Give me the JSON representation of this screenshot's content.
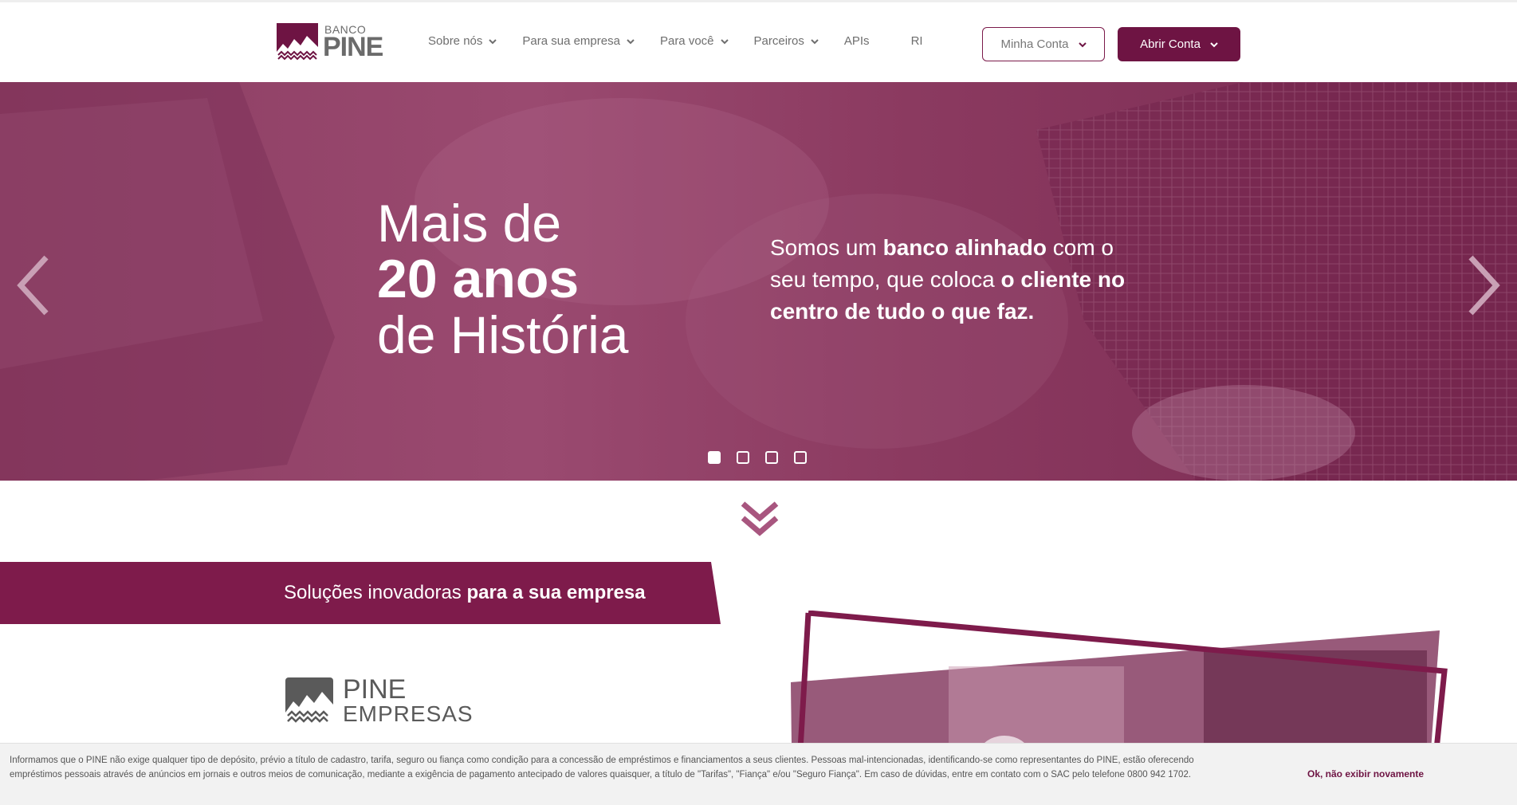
{
  "colors": {
    "brand": "#6e1443",
    "hero": "#8c3d62",
    "text": "#6e6e6e"
  },
  "header": {
    "logo_small": "BANCO",
    "logo_big": "PINE",
    "nav": [
      {
        "label": "Sobre nós",
        "has_dropdown": true
      },
      {
        "label": "Para sua empresa",
        "has_dropdown": true
      },
      {
        "label": "Para você",
        "has_dropdown": true
      },
      {
        "label": "Parceiros",
        "has_dropdown": true
      },
      {
        "label": "APIs",
        "has_dropdown": false
      },
      {
        "label": "RI",
        "has_dropdown": false
      }
    ],
    "minha_conta": "Minha Conta",
    "abrir_conta": "Abrir Conta"
  },
  "hero": {
    "title_line1": "Mais de",
    "title_line2": "20 anos",
    "title_line3": "de História",
    "text_part1": "Somos um ",
    "text_bold1": "banco alinhado",
    "text_part2": " com o seu tempo, que coloca ",
    "text_bold2": "o cliente no centro de tudo o que faz.",
    "slides_total": 4,
    "active_slide": 1
  },
  "section": {
    "title_regular": "Soluções inovadoras ",
    "title_bold": "para a sua empresa",
    "brand_line1": "PINE",
    "brand_line2": "EMPRESAS"
  },
  "cookie": {
    "text": "Informamos que o PINE não exige qualquer tipo de depósito, prévio a título de cadastro, tarifa, seguro ou fiança como condição para a concessão de empréstimos e financiamentos a seus clientes. Pessoas mal-intencionadas, identificando-se como representantes do PINE, estão oferecendo empréstimos pessoais através de anúncios em jornais e outros meios de comunicação, mediante a exigência de pagamento antecipado de valores quaisquer, a título de \"Tarifas\", \"Fiança\" e/ou \"Seguro Fiança\". Em caso de dúvidas, entre em contato com o SAC pelo telefone 0800 942 1702.",
    "button": "Ok, não exibir novamente"
  }
}
